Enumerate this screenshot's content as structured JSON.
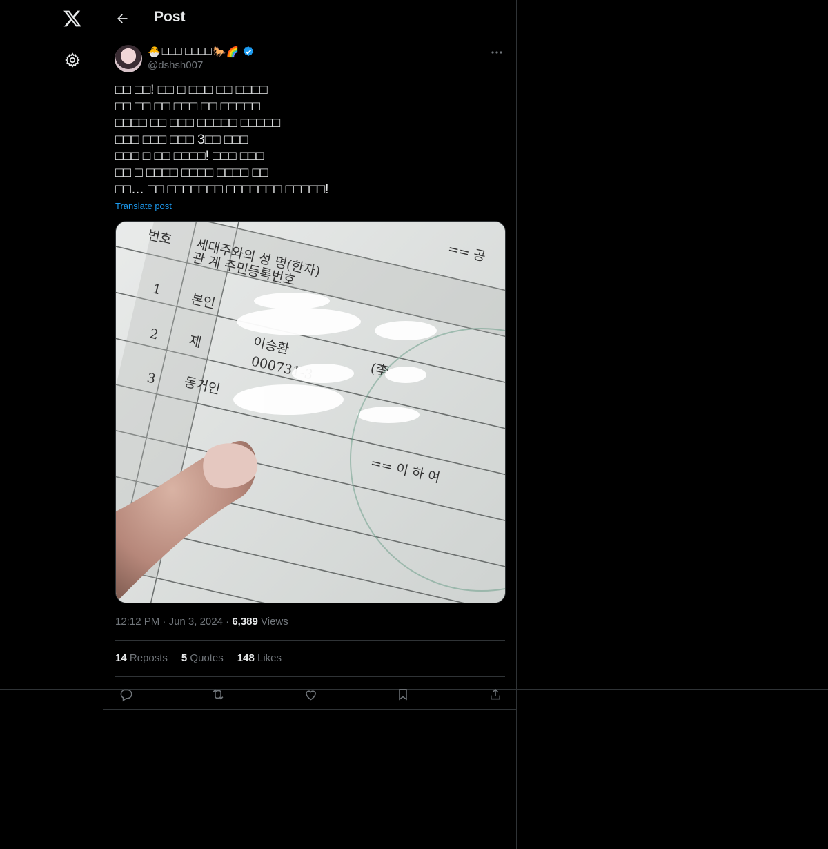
{
  "nav": {
    "logo_icon": "x-logo-icon",
    "settings_icon": "gear-icon"
  },
  "header": {
    "title": "Post"
  },
  "author": {
    "display_name": " \u0000\u0000\u0000 \u0000\u0000\u0000\u0000",
    "name_text": "□□□ □□□□",
    "prefix_emoji": "🐣",
    "suffix_emoji": "🐎🌈",
    "handle": "@dshsh007"
  },
  "tweet": {
    "lines": [
      "□□ □□! □□ □ □□□ □□ □□□□",
      "□□ □□ □□ □□□ □□ □□□□□",
      "□□□□ □□ □□□ □□□□□ □□□□□",
      "□□□ □□□ □□□ 3□□ □□□",
      "□□□ □ □□ □□□□! □□□ □□□",
      "□□ □ □□□□ □□□□ □□□□ □□",
      "□□… □□ □□□□□□□ □□□□□□□ □□□□□!"
    ],
    "translate": "Translate post"
  },
  "media": {
    "doc_labels": [
      "번호",
      "세대주와의 성 명(한자)",
      "관 계 주민등록번호",
      "== 공",
      "1",
      "본인",
      "2",
      "제",
      "이승환",
      "000731-3",
      "(李",
      "3",
      "동거인",
      "== 이 하 여"
    ]
  },
  "meta": {
    "time": "12:12 PM",
    "sep1": "·",
    "date": "Jun 3, 2024",
    "sep2": "·",
    "views_count": "6,389",
    "views_label": "Views"
  },
  "stats": {
    "reposts_count": "14",
    "reposts_label": "Reposts",
    "quotes_count": "5",
    "quotes_label": "Quotes",
    "likes_count": "148",
    "likes_label": "Likes"
  },
  "colors": {
    "background": "#000000",
    "text": "#e7e9ea",
    "muted": "#71767b",
    "link": "#1d9bf0",
    "border": "#2f3336"
  }
}
